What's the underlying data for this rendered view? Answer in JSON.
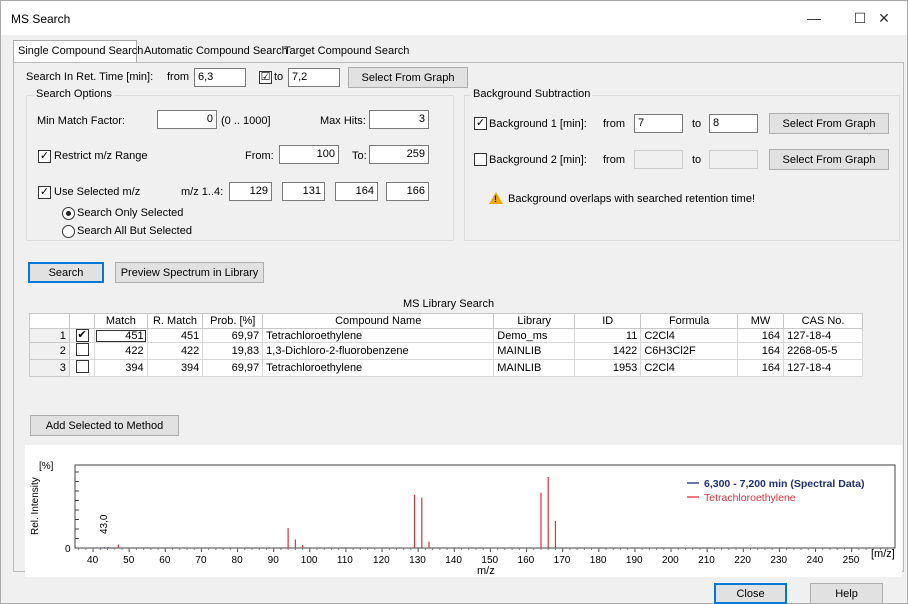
{
  "window": {
    "title": "MS Search",
    "minimize": "—",
    "maximize": "☐",
    "close": "✕"
  },
  "tabs": [
    {
      "label": "Single Compound Search"
    },
    {
      "label": "Automatic Compound Search"
    },
    {
      "label": "Target Compound Search"
    }
  ],
  "ret_time": {
    "label": "Search In Ret. Time [min]:",
    "from_label": "from",
    "from_value": "6,3",
    "to_checked": "☑",
    "to_label": "to",
    "to_value": "7,2",
    "select_button": "Select From Graph"
  },
  "search_options": {
    "title": "Search Options",
    "min_match_label": "Min Match Factor:",
    "min_match_value": "0",
    "min_match_range": "(0 .. 1000]",
    "max_hits_label": "Max Hits:",
    "max_hits_value": "3",
    "restrict_label": "Restrict m/z Range",
    "from_label": "From:",
    "from_value": "100",
    "to_label": "To:",
    "to_value": "259",
    "use_selected_label": "Use Selected m/z",
    "mz_label": "m/z 1..4:",
    "mz_values": [
      "129",
      "131",
      "164",
      "166"
    ],
    "radio_only": "Search Only Selected",
    "radio_all_but": "Search All But Selected"
  },
  "background": {
    "title": "Background Subtraction",
    "bg1_label": "Background 1 [min]:",
    "bg1_from_label": "from",
    "bg1_from": "7",
    "bg1_to_label": "to",
    "bg1_to": "8",
    "bg2_label": "Background 2 [min]:",
    "bg2_from_label": "from",
    "bg2_to_label": "to",
    "select_button": "Select From Graph",
    "warning": "Background overlaps with searched retention time!"
  },
  "actions": {
    "search": "Search",
    "preview": "Preview Spectrum in Library",
    "add_selected": "Add Selected to Method"
  },
  "results": {
    "caption": "MS Library Search",
    "columns": [
      "",
      "",
      "Match",
      "R. Match",
      "Prob. [%]",
      "Compound Name",
      "Library",
      "ID",
      "Formula",
      "MW",
      "CAS No."
    ],
    "rows": [
      {
        "n": "1",
        "checked": "✔",
        "match": "451",
        "rmatch": "451",
        "prob": "69,97",
        "name": "Tetrachloroethylene",
        "library": "Demo_ms",
        "id": "11",
        "formula": "C2Cl4",
        "mw": "164",
        "cas": "127-18-4"
      },
      {
        "n": "2",
        "checked": "",
        "match": "422",
        "rmatch": "422",
        "prob": "19,83",
        "name": "1,3-Dichloro-2-fluorobenzene",
        "library": "MAINLIB",
        "id": "1422",
        "formula": "C6H3Cl2F",
        "mw": "164",
        "cas": "2268-05-5"
      },
      {
        "n": "3",
        "checked": "",
        "match": "394",
        "rmatch": "394",
        "prob": "69,97",
        "name": "Tetrachloroethylene",
        "library": "MAINLIB",
        "id": "1953",
        "formula": "C2Cl4",
        "mw": "164",
        "cas": "127-18-4"
      }
    ]
  },
  "chart_data": {
    "type": "bar",
    "ylabel": "Rel. Intensity",
    "yunit": "[%]",
    "xlabel": "m/z",
    "xunit": "[m/z]",
    "xlim": [
      35,
      262
    ],
    "xticks": [
      "40",
      "50",
      "60",
      "70",
      "80",
      "90",
      "100",
      "110",
      "120",
      "130",
      "140",
      "150",
      "160",
      "170",
      "180",
      "190",
      "200",
      "210",
      "220",
      "230",
      "240",
      "250"
    ],
    "yticks": [
      "0"
    ],
    "peak_annotation": {
      "x": 43,
      "text": "43,0"
    },
    "legend": [
      {
        "name": "6,300 - 7,200 min (Spectral Data)",
        "color": "#1f2f7a"
      },
      {
        "name": "Tetrachloroethylene",
        "color": "#e0303a"
      }
    ],
    "series": [
      {
        "name": "6,300 - 7,200 min (Spectral Data)",
        "color": "#1f2f7a",
        "x": [
          38,
          40,
          41,
          42,
          43,
          44,
          45,
          47,
          48,
          50,
          55,
          57,
          60,
          62,
          63,
          65,
          68,
          70,
          71,
          74,
          75,
          77,
          82,
          83,
          85,
          87,
          88,
          96,
          99,
          100,
          101,
          113,
          115,
          116,
          121,
          123,
          125,
          128,
          138,
          140,
          141,
          144,
          145,
          149,
          151,
          153,
          156,
          160,
          162,
          171,
          176,
          183,
          186,
          188,
          194,
          197,
          207,
          209,
          218,
          221,
          225,
          237,
          244,
          249,
          251,
          253
        ],
        "values": [
          0.4,
          0.5,
          0.6,
          0.8,
          1.0,
          1.2,
          0.5,
          0.6,
          0.4,
          0.6,
          0.5,
          0.6,
          0.5,
          0.4,
          0.5,
          0.4,
          0.4,
          0.5,
          0.6,
          0.4,
          0.5,
          0.4,
          0.4,
          0.5,
          0.4,
          0.4,
          0.5,
          0.3,
          0.3,
          0.3,
          0.3,
          0.3,
          0.3,
          0.3,
          0.3,
          0.3,
          0.3,
          0.3,
          0.3,
          0.3,
          0.3,
          0.3,
          0.3,
          0.3,
          0.3,
          0.3,
          0.3,
          0.3,
          0.3,
          0.3,
          0.3,
          0.3,
          0.3,
          0.3,
          0.3,
          0.3,
          0.3,
          0.3,
          0.3,
          0.3,
          0.3,
          0.3,
          0.3,
          0.3,
          0.3,
          0.3
        ]
      },
      {
        "name": "Tetrachloroethylene",
        "color": "#e0303a",
        "x": [
          47,
          94,
          96,
          98,
          129,
          131,
          133,
          164,
          166,
          168
        ],
        "values": [
          5,
          28,
          12,
          4,
          75,
          71,
          9,
          78,
          100,
          38
        ]
      }
    ]
  },
  "footer": {
    "close": "Close",
    "help": "Help"
  }
}
